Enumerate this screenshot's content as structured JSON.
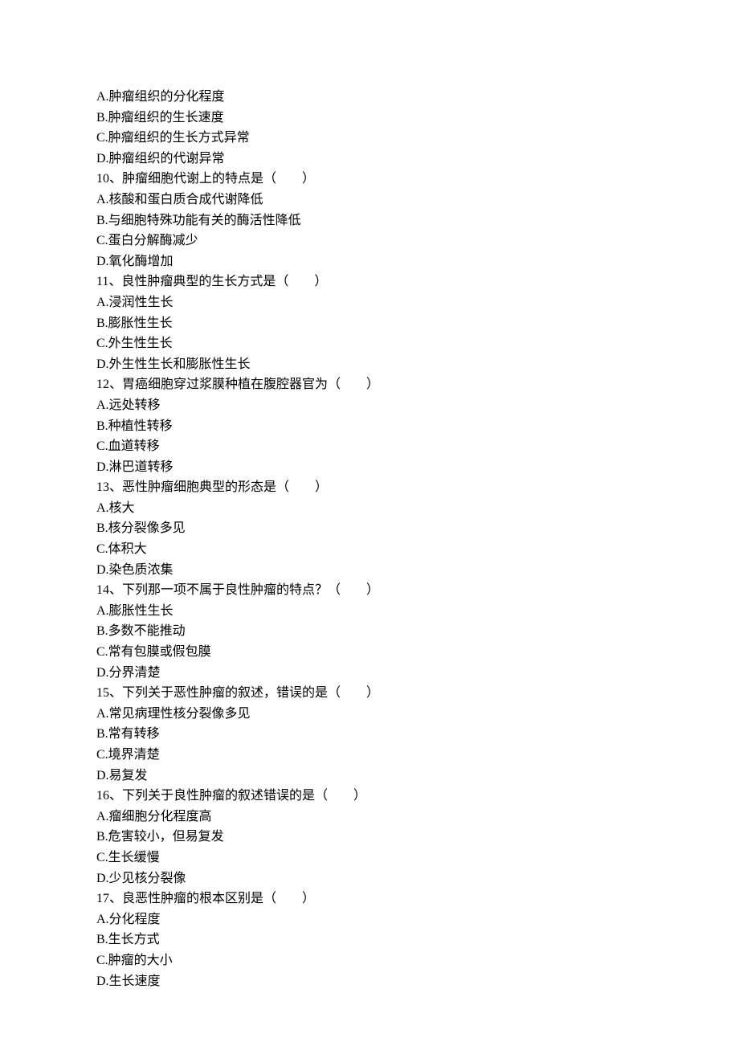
{
  "lines": [
    "A.肿瘤组织的分化程度",
    "B.肿瘤组织的生长速度",
    "C.肿瘤组织的生长方式异常",
    "D.肿瘤组织的代谢异常",
    "10、肿瘤细胞代谢上的特点是（　　）",
    "A.核酸和蛋白质合成代谢降低",
    "B.与细胞特殊功能有关的酶活性降低",
    "C.蛋白分解酶减少",
    "D.氧化酶增加",
    "11、良性肿瘤典型的生长方式是（　　）",
    "A.浸润性生长",
    "B.膨胀性生长",
    "C.外生性生长",
    "D.外生性生长和膨胀性生长",
    "12、胃癌细胞穿过浆膜种植在腹腔器官为（　　）",
    "A.远处转移",
    "B.种植性转移",
    "C.血道转移",
    "D.淋巴道转移",
    "13、恶性肿瘤细胞典型的形态是（　　）",
    "A.核大",
    "B.核分裂像多见",
    "C.体积大",
    "D.染色质浓集",
    "14、下列那一项不属于良性肿瘤的特点？（　　）",
    "A.膨胀性生长",
    "B.多数不能推动",
    "C.常有包膜或假包膜",
    "D.分界清楚",
    "15、下列关于恶性肿瘤的叙述，错误的是（　　）",
    "A.常见病理性核分裂像多见",
    "B.常有转移",
    "C.境界清楚",
    "D.易复发",
    "16、下列关于良性肿瘤的叙述错误的是（　　）",
    "A.瘤细胞分化程度高",
    "B.危害较小，但易复发",
    "C.生长缓慢",
    "D.少见核分裂像",
    "17、良恶性肿瘤的根本区别是（　　）",
    "A.分化程度",
    "B.生长方式",
    "C.肿瘤的大小",
    "D.生长速度"
  ]
}
